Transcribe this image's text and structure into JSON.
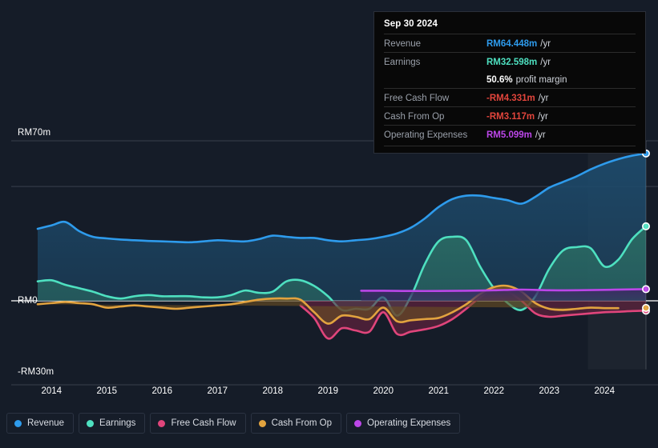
{
  "chart_data": {
    "type": "area",
    "title": "",
    "xlabel": "",
    "ylabel": "",
    "currency_prefix": "RM",
    "grid": true,
    "legend_position": "bottom",
    "y_axis": {
      "labels": [
        "RM70m",
        "RM0",
        "-RM30m"
      ],
      "values": [
        70,
        0,
        -30
      ],
      "ylim": [
        -30,
        70
      ],
      "gridlines": [
        70,
        50,
        0
      ]
    },
    "x_axis": {
      "tick_labels": [
        "2014",
        "2015",
        "2016",
        "2017",
        "2018",
        "2019",
        "2020",
        "2021",
        "2022",
        "2023",
        "2024"
      ],
      "range": [
        "2013-09",
        "2024-09"
      ]
    },
    "series": [
      {
        "name": "Revenue",
        "color": "#2e9bec",
        "fill": "#1d4a6b",
        "end_value": 64.448,
        "x": [
          2013.75,
          2014.0,
          2014.25,
          2014.5,
          2014.75,
          2015.0,
          2015.25,
          2015.5,
          2015.75,
          2016.0,
          2016.25,
          2016.5,
          2016.75,
          2017.0,
          2017.25,
          2017.5,
          2017.75,
          2018.0,
          2018.25,
          2018.5,
          2018.75,
          2019.0,
          2019.25,
          2019.5,
          2019.75,
          2020.0,
          2020.25,
          2020.5,
          2020.75,
          2021.0,
          2021.25,
          2021.5,
          2021.75,
          2022.0,
          2022.25,
          2022.5,
          2022.75,
          2023.0,
          2023.25,
          2023.5,
          2023.75,
          2024.0,
          2024.25,
          2024.5,
          2024.75
        ],
        "values": [
          31.5,
          33.0,
          34.5,
          30.5,
          28.0,
          27.3,
          26.8,
          26.5,
          26.2,
          26.0,
          25.8,
          25.6,
          26.0,
          26.5,
          26.2,
          26.0,
          27.0,
          28.5,
          28.0,
          27.5,
          27.5,
          26.5,
          26.0,
          26.5,
          27.0,
          28.0,
          29.5,
          32.0,
          36.0,
          41.0,
          44.5,
          46.0,
          46.0,
          45.0,
          44.0,
          42.5,
          45.5,
          49.5,
          52.0,
          54.5,
          57.5,
          60.0,
          62.0,
          63.5,
          64.448
        ]
      },
      {
        "name": "Earnings",
        "color": "#4ee0c0",
        "fill": "#2a6b63",
        "end_value": 32.598,
        "x": [
          2013.75,
          2014.0,
          2014.25,
          2014.5,
          2014.75,
          2015.0,
          2015.25,
          2015.5,
          2015.75,
          2016.0,
          2016.25,
          2016.5,
          2016.75,
          2017.0,
          2017.25,
          2017.5,
          2017.75,
          2018.0,
          2018.25,
          2018.5,
          2018.75,
          2019.0,
          2019.25,
          2019.5,
          2019.75,
          2020.0,
          2020.25,
          2020.5,
          2020.75,
          2021.0,
          2021.25,
          2021.5,
          2021.75,
          2022.0,
          2022.25,
          2022.5,
          2022.75,
          2023.0,
          2023.25,
          2023.5,
          2023.75,
          2024.0,
          2024.25,
          2024.5,
          2024.75
        ],
        "values": [
          8.5,
          9.0,
          7.0,
          5.5,
          4.0,
          2.0,
          1.0,
          2.0,
          2.5,
          2.0,
          2.0,
          2.0,
          1.5,
          1.5,
          2.5,
          4.5,
          3.5,
          4.0,
          8.5,
          9.0,
          6.5,
          2.0,
          -4.0,
          -3.5,
          -3.5,
          1.5,
          -6.5,
          2.0,
          16.0,
          26.0,
          28.0,
          26.5,
          15.0,
          5.5,
          -1.0,
          -4.0,
          2.0,
          14.0,
          22.0,
          23.5,
          23.0,
          15.0,
          18.0,
          27.0,
          32.598
        ]
      },
      {
        "name": "Free Cash Flow",
        "color": "#e0457b",
        "fill": "#6b2440",
        "end_value": -4.331,
        "x": [
          2018.5,
          2018.75,
          2019.0,
          2019.25,
          2019.5,
          2019.75,
          2020.0,
          2020.25,
          2020.5,
          2020.75,
          2021.0,
          2021.25,
          2021.5,
          2021.75,
          2022.0,
          2022.25,
          2022.5,
          2022.75,
          2023.0,
          2023.25,
          2023.5,
          2023.75,
          2024.0,
          2024.25,
          2024.5,
          2024.75
        ],
        "values": [
          -2.0,
          -7.5,
          -16.5,
          -12.0,
          -13.0,
          -13.5,
          -5.0,
          -14.5,
          -13.5,
          -12.5,
          -11.0,
          -8.0,
          -3.5,
          1.5,
          5.0,
          4.0,
          0.0,
          -5.5,
          -7.0,
          -6.5,
          -6.0,
          -5.5,
          -5.0,
          -4.8,
          -4.5,
          -4.331
        ]
      },
      {
        "name": "Cash From Op",
        "color": "#e2a33f",
        "fill": "#6b4f22",
        "end_value": -3.117,
        "x": [
          2013.75,
          2014.0,
          2014.25,
          2014.5,
          2014.75,
          2015.0,
          2015.25,
          2015.5,
          2015.75,
          2016.0,
          2016.25,
          2016.5,
          2016.75,
          2017.0,
          2017.25,
          2017.5,
          2017.75,
          2018.0,
          2018.25,
          2018.5,
          2018.75,
          2019.0,
          2019.25,
          2019.5,
          2019.75,
          2020.0,
          2020.25,
          2020.5,
          2020.75,
          2021.0,
          2021.25,
          2021.5,
          2021.75,
          2022.0,
          2022.25,
          2022.5,
          2022.75,
          2023.0,
          2023.25,
          2023.5,
          2023.75,
          2024.0,
          2024.25,
          2024.5,
          2024.75
        ],
        "values": [
          -1.5,
          -1.0,
          -0.5,
          -1.0,
          -1.5,
          -3.0,
          -2.5,
          -2.0,
          -2.5,
          -3.0,
          -3.5,
          -3.0,
          -2.5,
          -2.0,
          -1.5,
          -0.5,
          0.5,
          1.0,
          1.0,
          0.5,
          -5.0,
          -10.0,
          -6.5,
          -7.0,
          -8.0,
          -3.0,
          -9.0,
          -8.5,
          -8.0,
          -7.5,
          -5.0,
          -1.5,
          3.0,
          6.0,
          6.5,
          4.0,
          -1.0,
          -3.5,
          -4.0,
          -3.5,
          -3.0,
          -3.2,
          -3.2,
          -3.117
        ]
      },
      {
        "name": "Operating Expenses",
        "color": "#bb46e8",
        "fill": "#3c2a63",
        "end_value": 5.099,
        "x": [
          2019.6,
          2020.0,
          2020.5,
          2021.0,
          2021.5,
          2022.0,
          2022.5,
          2023.0,
          2023.5,
          2024.0,
          2024.5,
          2024.75
        ],
        "values": [
          4.4,
          4.4,
          4.3,
          4.3,
          4.4,
          4.6,
          4.9,
          4.6,
          4.6,
          4.8,
          5.0,
          5.099
        ]
      }
    ],
    "highlight_band": {
      "from": 2023.7,
      "to": 2024.75
    }
  },
  "tooltip": {
    "date": "Sep 30 2024",
    "rows": [
      {
        "key": "Revenue",
        "value": "RM64.448m",
        "unit": "/yr",
        "color": "#2e9bec"
      },
      {
        "key": "Earnings",
        "value": "RM32.598m",
        "unit": "/yr",
        "color": "#4ee0c0"
      },
      {
        "key": "",
        "value": "50.6%",
        "unit": "profit margin",
        "color": "#ffffff"
      },
      {
        "key": "Free Cash Flow",
        "value": "-RM4.331m",
        "unit": "/yr",
        "color": "#e2453c"
      },
      {
        "key": "Cash From Op",
        "value": "-RM3.117m",
        "unit": "/yr",
        "color": "#e2453c"
      },
      {
        "key": "Operating Expenses",
        "value": "RM5.099m",
        "unit": "/yr",
        "color": "#bb46e8"
      }
    ]
  },
  "legend": {
    "items": [
      {
        "label": "Revenue",
        "color": "#2e9bec"
      },
      {
        "label": "Earnings",
        "color": "#4ee0c0"
      },
      {
        "label": "Free Cash Flow",
        "color": "#e0457b"
      },
      {
        "label": "Cash From Op",
        "color": "#e2a33f"
      },
      {
        "label": "Operating Expenses",
        "color": "#bb46e8"
      }
    ]
  }
}
